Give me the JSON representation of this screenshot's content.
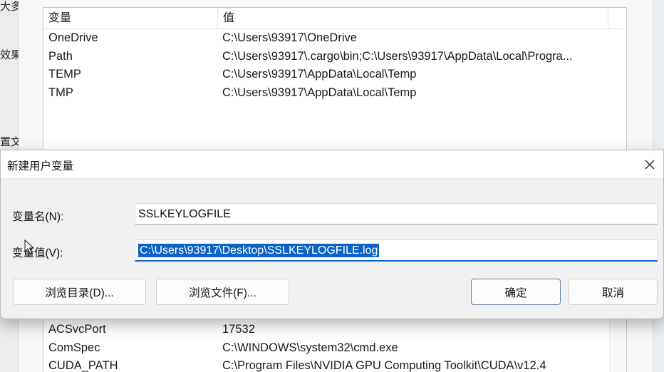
{
  "background": {
    "left_fragments": [
      "大多",
      "效果",
      "置文"
    ],
    "list_header": {
      "name_col": "变量",
      "value_col": "值"
    },
    "user_vars": [
      {
        "name": "OneDrive",
        "value": "C:\\Users\\93917\\OneDrive"
      },
      {
        "name": "Path",
        "value": "C:\\Users\\93917\\.cargo\\bin;C:\\Users\\93917\\AppData\\Local\\Progra..."
      },
      {
        "name": "TEMP",
        "value": "C:\\Users\\93917\\AppData\\Local\\Temp"
      },
      {
        "name": "TMP",
        "value": "C:\\Users\\93917\\AppData\\Local\\Temp"
      }
    ],
    "system_vars": [
      {
        "name": "ACSvcPort",
        "value": "17532"
      },
      {
        "name": "ComSpec",
        "value": "C:\\WINDOWS\\system32\\cmd.exe"
      },
      {
        "name": "CUDA_PATH",
        "value": "C:\\Program Files\\NVIDIA GPU Computing Toolkit\\CUDA\\v12.4"
      }
    ]
  },
  "dialog": {
    "title": "新建用户变量",
    "name_label": "变量名(N):",
    "name_value": "SSLKEYLOGFILE",
    "value_label": "变量值(V):",
    "value_value": "C:\\Users\\93917\\Desktop\\SSLKEYLOGFILE.log",
    "buttons": {
      "browse_dir": "浏览目录(D)...",
      "browse_file": "浏览文件(F)...",
      "ok": "确定",
      "cancel": "取消"
    }
  },
  "icons": {
    "close": "close-icon",
    "cursor": "mouse-cursor-icon"
  },
  "colors": {
    "selection": "#0a64c8",
    "focus_underline": "#0a64c8"
  }
}
